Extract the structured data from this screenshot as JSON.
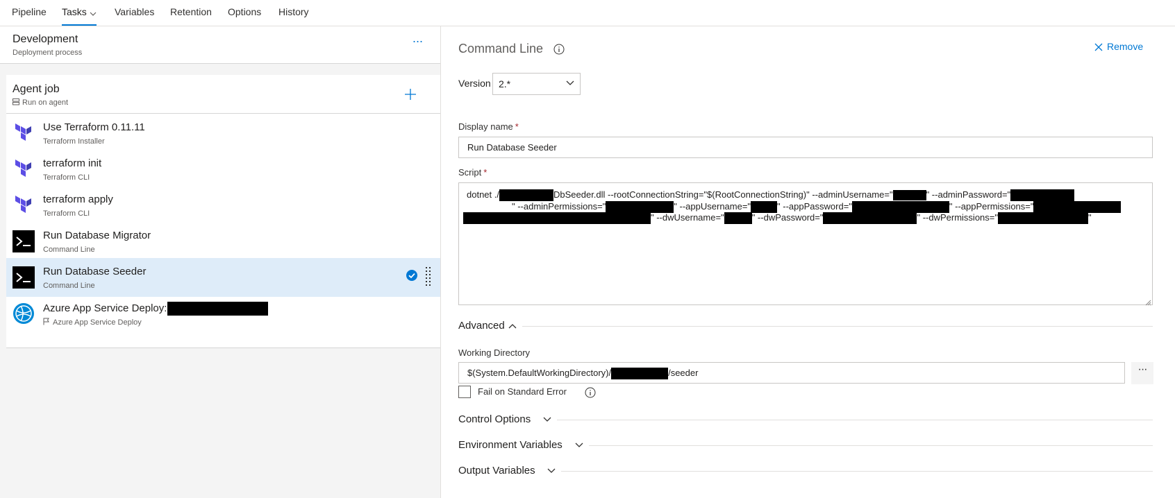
{
  "tabs": [
    {
      "label": "Pipeline"
    },
    {
      "label": "Tasks"
    },
    {
      "label": "Variables"
    },
    {
      "label": "Retention"
    },
    {
      "label": "Options"
    },
    {
      "label": "History"
    }
  ],
  "stage": {
    "title": "Development",
    "subtitle": "Deployment process",
    "more_label": "···"
  },
  "agent_job": {
    "title": "Agent job",
    "subtitle": "Run on agent"
  },
  "tasks": [
    {
      "title": "Use Terraform 0.11.11",
      "subtitle": "Terraform Installer",
      "icon": "terraform-icon"
    },
    {
      "title": "terraform init",
      "subtitle": "Terraform CLI",
      "icon": "terraform-icon"
    },
    {
      "title": "terraform apply",
      "subtitle": "Terraform CLI",
      "icon": "terraform-icon"
    },
    {
      "title": "Run Database Migrator",
      "subtitle": "Command Line",
      "icon": "command-line-icon"
    },
    {
      "title": "Run Database Seeder",
      "subtitle": "Command Line",
      "icon": "command-line-icon",
      "selected": true
    },
    {
      "title": "Azure App Service Deploy:",
      "subtitle": "Azure App Service Deploy",
      "icon": "azure-app-service-icon"
    }
  ],
  "details": {
    "heading": "Command Line",
    "remove_label": "Remove",
    "version_label": "Version",
    "version_value": "2.*",
    "display_name_label": "Display name",
    "display_name_value": "Run Database Seeder",
    "script_label": "Script",
    "script": {
      "l1a": "dotnet ./",
      "l1b": "DbSeeder.dll --rootConnectionString=\"$(RootConnectionString)\" --adminUsername=\"",
      "l1c": "\" --adminPassword=\"",
      "l2a": "\" --adminPermissions=\"",
      "l2b": "\" --appUsername=\"",
      "l2c": "\" --appPassword=\"",
      "l2d": "\" --appPermissions=\"",
      "l3a": "\" --dwUsername=\"",
      "l3b": "\" --dwPassword=\"",
      "l3c": "\" --dwPermissions=\"",
      "l3d": "\""
    },
    "advanced_label": "Advanced",
    "working_dir_label": "Working Directory",
    "working_dir_prefix": "$(System.DefaultWorkingDirectory)/",
    "working_dir_suffix": "/seeder",
    "working_dir_more": "···",
    "fail_on_stderr_label": "Fail on Standard Error",
    "fail_on_stderr_checked": false,
    "sections": [
      "Control Options",
      "Environment Variables",
      "Output Variables"
    ]
  },
  "colors": {
    "accent": "#0078d4",
    "terraform": "#5c4ee5",
    "selected_bg": "#deecf9",
    "required": "#a4262c"
  }
}
